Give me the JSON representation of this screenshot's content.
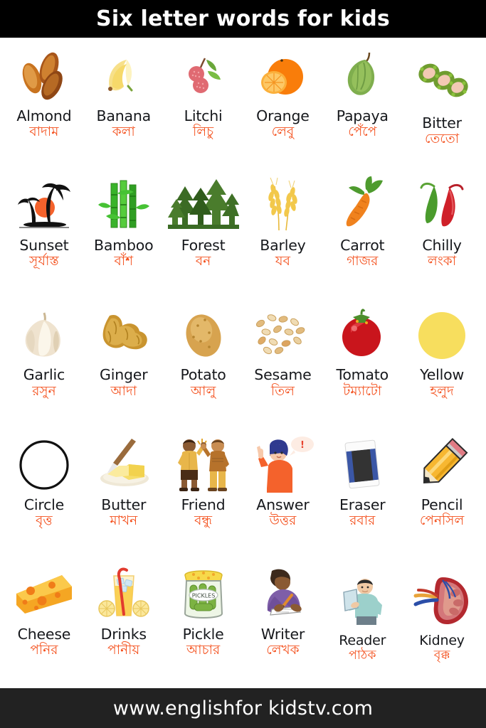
{
  "header": {
    "title": "Six letter words for kids"
  },
  "footer": {
    "url": "www.englishfor kidstv.com"
  },
  "colors": {
    "header_bg": "#000000",
    "footer_bg": "#222222",
    "page_bg": "#ffffff",
    "english_text": "#16181c",
    "bengali_text": "#f4511e"
  },
  "rows": [
    {
      "cells": [
        {
          "en": "Almond",
          "bn": "বাদাম",
          "icon": "almond-icon"
        },
        {
          "en": "Banana",
          "bn": "কলা",
          "icon": "banana-icon"
        },
        {
          "en": "Litchi",
          "bn": "লিচু",
          "icon": "litchi-icon"
        },
        {
          "en": "Orange",
          "bn": "লেবু",
          "icon": "orange-icon"
        },
        {
          "en": "Papaya",
          "bn": "পেঁপে",
          "icon": "papaya-icon"
        },
        {
          "en": "Bitter",
          "bn": "তেতো",
          "icon": "bitter-gourd-icon"
        }
      ]
    },
    {
      "cells": [
        {
          "en": "Sunset",
          "bn": "সূর্যাস্ত",
          "icon": "sunset-icon"
        },
        {
          "en": "Bamboo",
          "bn": "বাঁশ",
          "icon": "bamboo-icon"
        },
        {
          "en": "Forest",
          "bn": "বন",
          "icon": "forest-icon"
        },
        {
          "en": "Barley",
          "bn": "যব",
          "icon": "barley-icon"
        },
        {
          "en": "Carrot",
          "bn": "গাজর",
          "icon": "carrot-icon"
        },
        {
          "en": "Chilly",
          "bn": "লংকা",
          "icon": "chilly-icon"
        }
      ]
    },
    {
      "cells": [
        {
          "en": "Garlic",
          "bn": "রসুন",
          "icon": "garlic-icon"
        },
        {
          "en": "Ginger",
          "bn": "আদা",
          "icon": "ginger-icon"
        },
        {
          "en": "Potato",
          "bn": "আলু",
          "icon": "potato-icon"
        },
        {
          "en": "Sesame",
          "bn": "তিল",
          "icon": "sesame-icon"
        },
        {
          "en": "Tomato",
          "bn": "টম্যাটো",
          "icon": "tomato-icon"
        },
        {
          "en": "Yellow",
          "bn": "হলুদ",
          "icon": "yellow-circle-icon"
        }
      ]
    },
    {
      "cells": [
        {
          "en": "Circle",
          "bn": "বৃত্ত",
          "icon": "circle-outline-icon"
        },
        {
          "en": "Butter",
          "bn": "মাখন",
          "icon": "butter-icon"
        },
        {
          "en": "Friend",
          "bn": "বন্ধু",
          "icon": "friends-icon"
        },
        {
          "en": "Answer",
          "bn": "উত্তর",
          "icon": "answer-person-icon"
        },
        {
          "en": "Eraser",
          "bn": "রবার",
          "icon": "eraser-icon"
        },
        {
          "en": "Pencil",
          "bn": "পেনসিল",
          "icon": "pencil-icon"
        }
      ]
    },
    {
      "cells": [
        {
          "en": "Cheese",
          "bn": "পনির",
          "icon": "cheese-icon"
        },
        {
          "en": "Drinks",
          "bn": "পানীয়",
          "icon": "lemonade-icon"
        },
        {
          "en": "Pickle",
          "bn": "আচার",
          "icon": "pickle-jar-icon",
          "label": "PICKLES"
        },
        {
          "en": "Writer",
          "bn": "লেখক",
          "icon": "writer-icon"
        },
        {
          "en": "Reader",
          "bn": "পাঠক",
          "icon": "reader-icon"
        },
        {
          "en": "Kidney",
          "bn": "বৃক্ক",
          "icon": "kidney-icon"
        }
      ]
    }
  ]
}
